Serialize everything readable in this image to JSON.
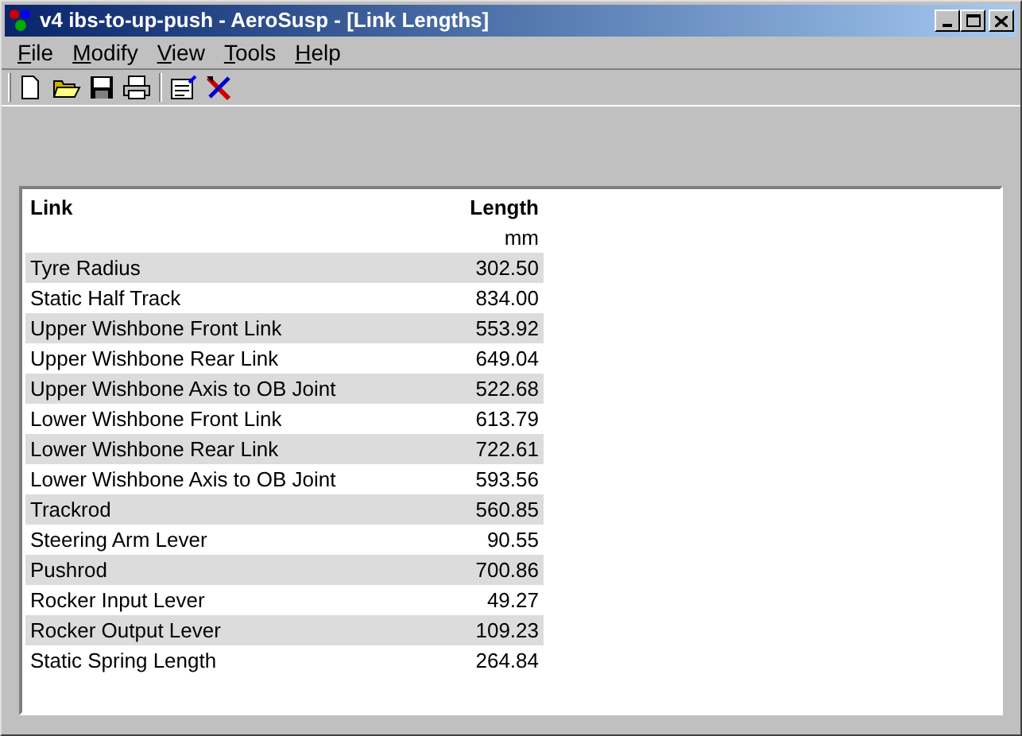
{
  "window": {
    "title": "v4 ibs-to-up-push - AeroSusp - [Link Lengths]"
  },
  "menu": [
    "File",
    "Modify",
    "View",
    "Tools",
    "Help"
  ],
  "table": {
    "columns": [
      {
        "label": "Link"
      },
      {
        "label": "Length",
        "unit": "mm"
      }
    ],
    "rows": [
      [
        "Tyre Radius",
        "302.50"
      ],
      [
        "Static Half Track",
        "834.00"
      ],
      [
        "Upper Wishbone Front Link",
        "553.92"
      ],
      [
        "Upper Wishbone Rear Link",
        "649.04"
      ],
      [
        "Upper Wishbone Axis to OB Joint",
        "522.68"
      ],
      [
        "Lower Wishbone Front Link",
        "613.79"
      ],
      [
        "Lower Wishbone Rear Link",
        "722.61"
      ],
      [
        "Lower Wishbone Axis to OB Joint",
        "593.56"
      ],
      [
        "Trackrod",
        "560.85"
      ],
      [
        "Steering Arm Lever",
        "90.55"
      ],
      [
        "Pushrod",
        "700.86"
      ],
      [
        "Rocker Input Lever",
        "49.27"
      ],
      [
        "Rocker Output Lever",
        "109.23"
      ],
      [
        "Static Spring Length",
        "264.84"
      ]
    ]
  }
}
